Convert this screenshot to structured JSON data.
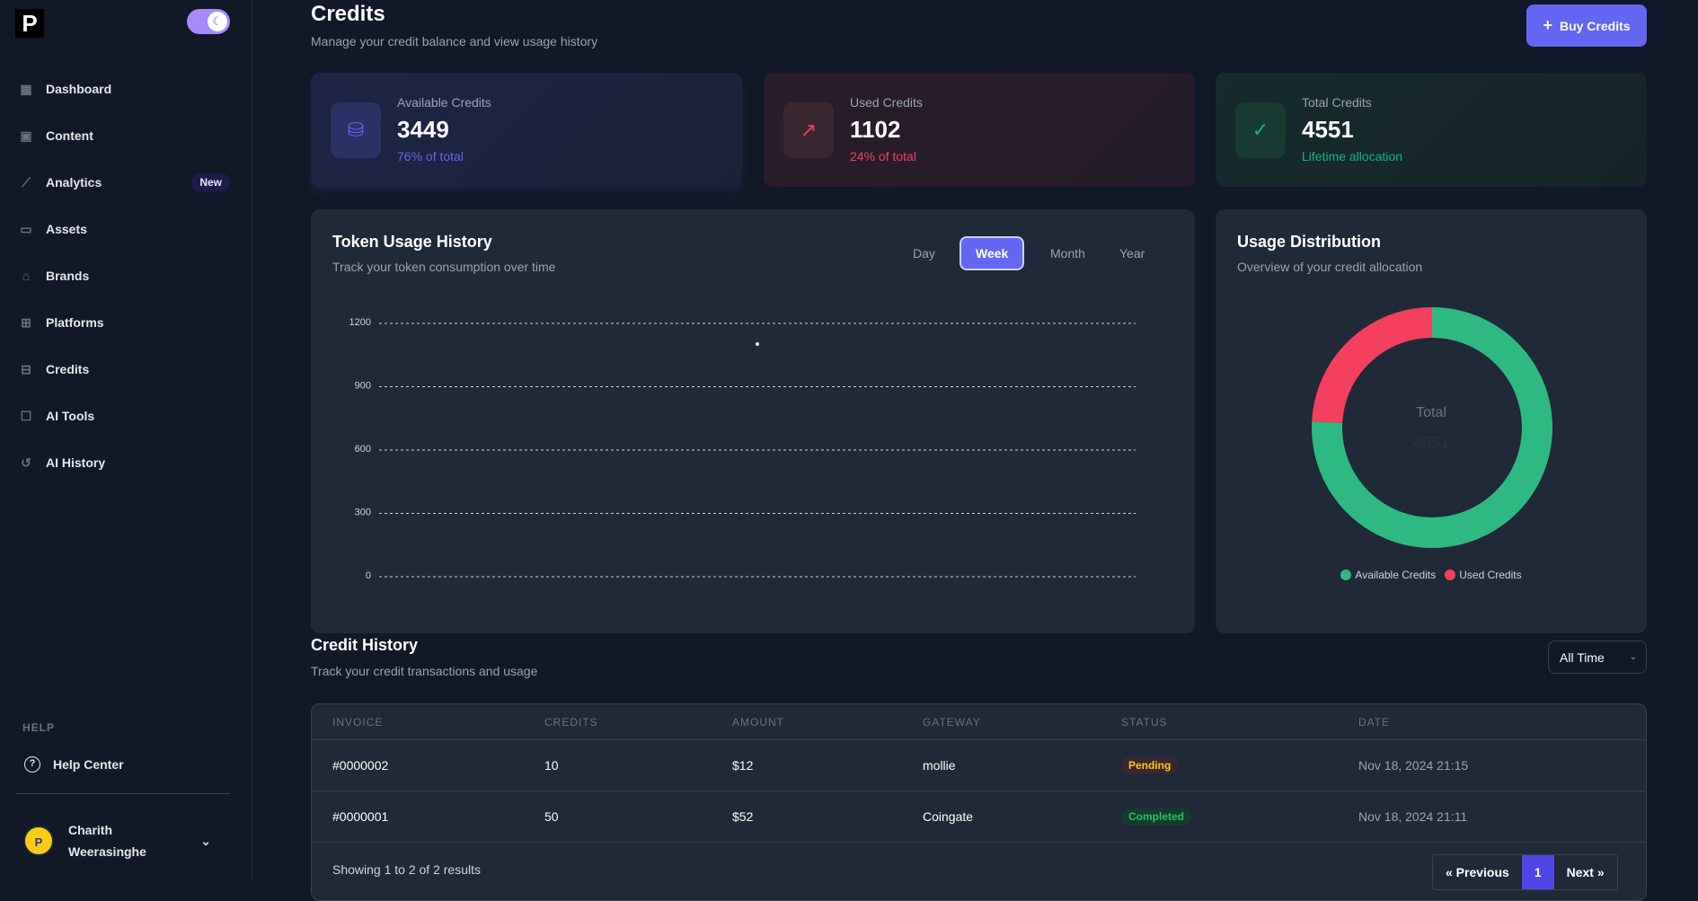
{
  "sidebar": {
    "logo": "P",
    "items": [
      {
        "label": "Dashboard",
        "icon": "dashboard-icon"
      },
      {
        "label": "Content",
        "icon": "images-icon"
      },
      {
        "label": "Analytics",
        "icon": "chart-line-icon",
        "badge": "New"
      },
      {
        "label": "Assets",
        "icon": "folder-icon"
      },
      {
        "label": "Brands",
        "icon": "store-icon"
      },
      {
        "label": "Platforms",
        "icon": "grid-icon"
      },
      {
        "label": "Credits",
        "icon": "folder-minus-icon"
      },
      {
        "label": "AI Tools",
        "icon": "robot-icon"
      },
      {
        "label": "AI History",
        "icon": "history-icon"
      }
    ],
    "help_heading": "HELP",
    "help_center": "Help Center",
    "user": {
      "first": "Charith",
      "last": "Weerasinghe"
    }
  },
  "header": {
    "title": "Credits",
    "subtitle": "Manage your credit balance and view usage history",
    "buy_label": "Buy Credits"
  },
  "stats": [
    {
      "label": "Available Credits",
      "value": "3449",
      "note": "76% of total",
      "color": "#6366f1"
    },
    {
      "label": "Used Credits",
      "value": "1102",
      "note": "24% of total",
      "color": "#f43f5e"
    },
    {
      "label": "Total Credits",
      "value": "4551",
      "note": "Lifetime allocation",
      "color": "#10b981"
    }
  ],
  "usage": {
    "title": "Token Usage History",
    "subtitle": "Track your token consumption over time",
    "ranges": [
      "Day",
      "Week",
      "Month",
      "Year"
    ],
    "active_range": "Week"
  },
  "distribution": {
    "title": "Usage Distribution",
    "subtitle": "Overview of your credit allocation",
    "center_label": "Total",
    "center_value": "4551"
  },
  "chart_data": [
    {
      "type": "line",
      "ylim": [
        0,
        1200
      ],
      "yticks": [
        "0",
        "300",
        "600",
        "900",
        "1200"
      ],
      "grid": true,
      "series": [
        {
          "values": [
            1102
          ]
        }
      ]
    },
    {
      "type": "pie",
      "legend": "bottom",
      "categories": [
        "Available Credits",
        "Used Credits"
      ],
      "values": [
        3449,
        1102
      ],
      "colors": [
        "#2fb982",
        "#f43f5e"
      ]
    }
  ],
  "history": {
    "title": "Credit History",
    "subtitle": "Track your credit transactions and usage",
    "filter": "All Time",
    "columns": [
      "INVOICE",
      "CREDITS",
      "AMOUNT",
      "GATEWAY",
      "STATUS",
      "DATE"
    ],
    "rows": [
      [
        "#0000002",
        "10",
        "$12",
        "mollie",
        "Pending",
        "Nov 18, 2024 21:15"
      ],
      [
        "#0000001",
        "50",
        "$52",
        "Coingate",
        "Completed",
        "Nov 18, 2024 21:11"
      ]
    ],
    "summary": "Showing 1 to 2 of 2 results",
    "prev": "« Previous",
    "page": "1",
    "next": "Next »"
  }
}
